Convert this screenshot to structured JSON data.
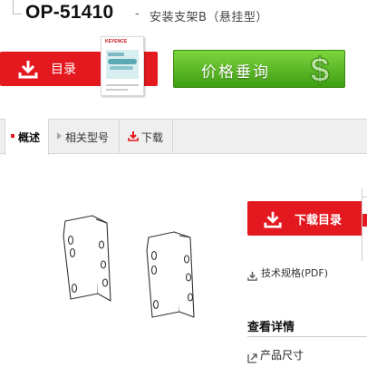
{
  "header": {
    "model": "OP-51410",
    "separator": "-",
    "subtitle": "安装支架B（悬挂型）"
  },
  "banner": {
    "catalog_label": "目录",
    "brochure_brand": "KEYENCE",
    "price_label": "价格垂询",
    "price_symbol": "$"
  },
  "tabs": [
    {
      "label": "概述",
      "active": true
    },
    {
      "label": "相关型号",
      "active": false
    },
    {
      "label": "下载",
      "active": false
    }
  ],
  "sidebar": {
    "download_catalog_label": "下载目录",
    "spec_link_label": "技术规格(PDF)",
    "details_title": "查看详情",
    "details_link_label": "产品尺寸"
  },
  "colors": {
    "accent_red": "#e3191f",
    "price_green": "#5cb82a"
  }
}
